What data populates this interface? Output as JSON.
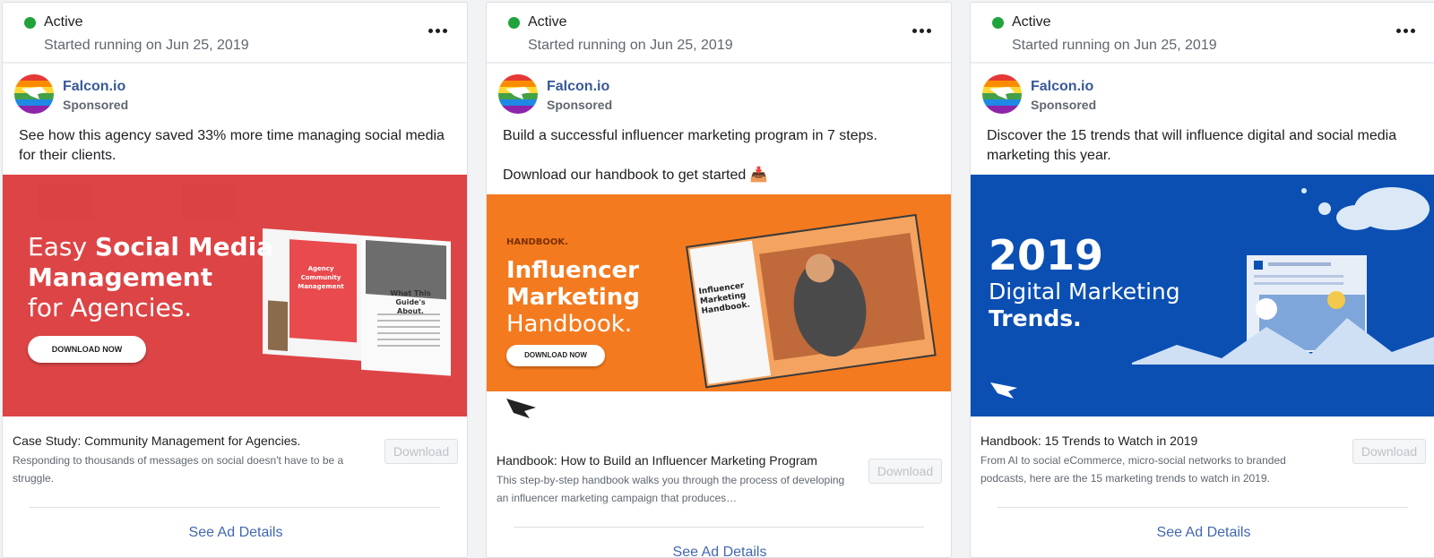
{
  "cards": [
    {
      "status": "Active",
      "started": "Started running on Jun 25, 2019",
      "page_name": "Falcon.io",
      "sponsored": "Sponsored",
      "text": [
        "See how this agency saved 33% more time managing social media for their clients."
      ],
      "creative": {
        "line1": "Easy ",
        "line1_bold": "Social Media",
        "line2": "Management",
        "line3": "for Agencies.",
        "button": "DOWNLOAD NOW",
        "book_cover_line1": "Agency Community",
        "book_cover_line2": "Management",
        "book_page_title": "What This Guide's About."
      },
      "link_headline": "Case Study: Community Management for Agencies.",
      "link_desc": "Responding to thousands of messages on social doesn't have to be a struggle.",
      "download": "Download",
      "details": "See Ad Details"
    },
    {
      "status": "Active",
      "started": "Started running on Jun 25, 2019",
      "page_name": "Falcon.io",
      "sponsored": "Sponsored",
      "text": [
        "Build a successful influencer marketing program in 7 steps.",
        "Download our handbook to get started 📥"
      ],
      "creative": {
        "eyebrow": "HANDBOOK.",
        "line1": "Influencer",
        "line2": "Marketing",
        "line3": "Handbook.",
        "button": "DOWNLOAD NOW",
        "book_line1": "Influencer",
        "book_line2": "Marketing",
        "book_line3": "Handbook."
      },
      "link_headline": "Handbook: How to Build an Influencer Marketing Program",
      "link_desc": "This step-by-step handbook walks you through the process of developing an influencer marketing campaign that produces…",
      "download": "Download",
      "details": "See Ad Details"
    },
    {
      "status": "Active",
      "started": "Started running on Jun 25, 2019",
      "page_name": "Falcon.io",
      "sponsored": "Sponsored",
      "text": [
        "Discover the 15 trends that will influence digital and social media marketing this year."
      ],
      "creative": {
        "line1": "2019",
        "line2": "Digital Marketing",
        "line3": "Trends."
      },
      "link_headline": "Handbook: 15 Trends to Watch in 2019",
      "link_desc": "From AI to social eCommerce, micro-social networks to branded podcasts, here are the 15 marketing trends to watch in 2019.",
      "download": "Download",
      "details": "See Ad Details"
    }
  ],
  "colors": {
    "active_dot": "#20a33a",
    "page_link": "#385898",
    "details_link": "#4267b2",
    "creative_red": "#e4474a",
    "creative_orange": "#f47a1f",
    "creative_blue": "#0b4fb3"
  },
  "icons": [
    "more-icon",
    "falcon-logo-icon",
    "inbox-tray-emoji"
  ]
}
